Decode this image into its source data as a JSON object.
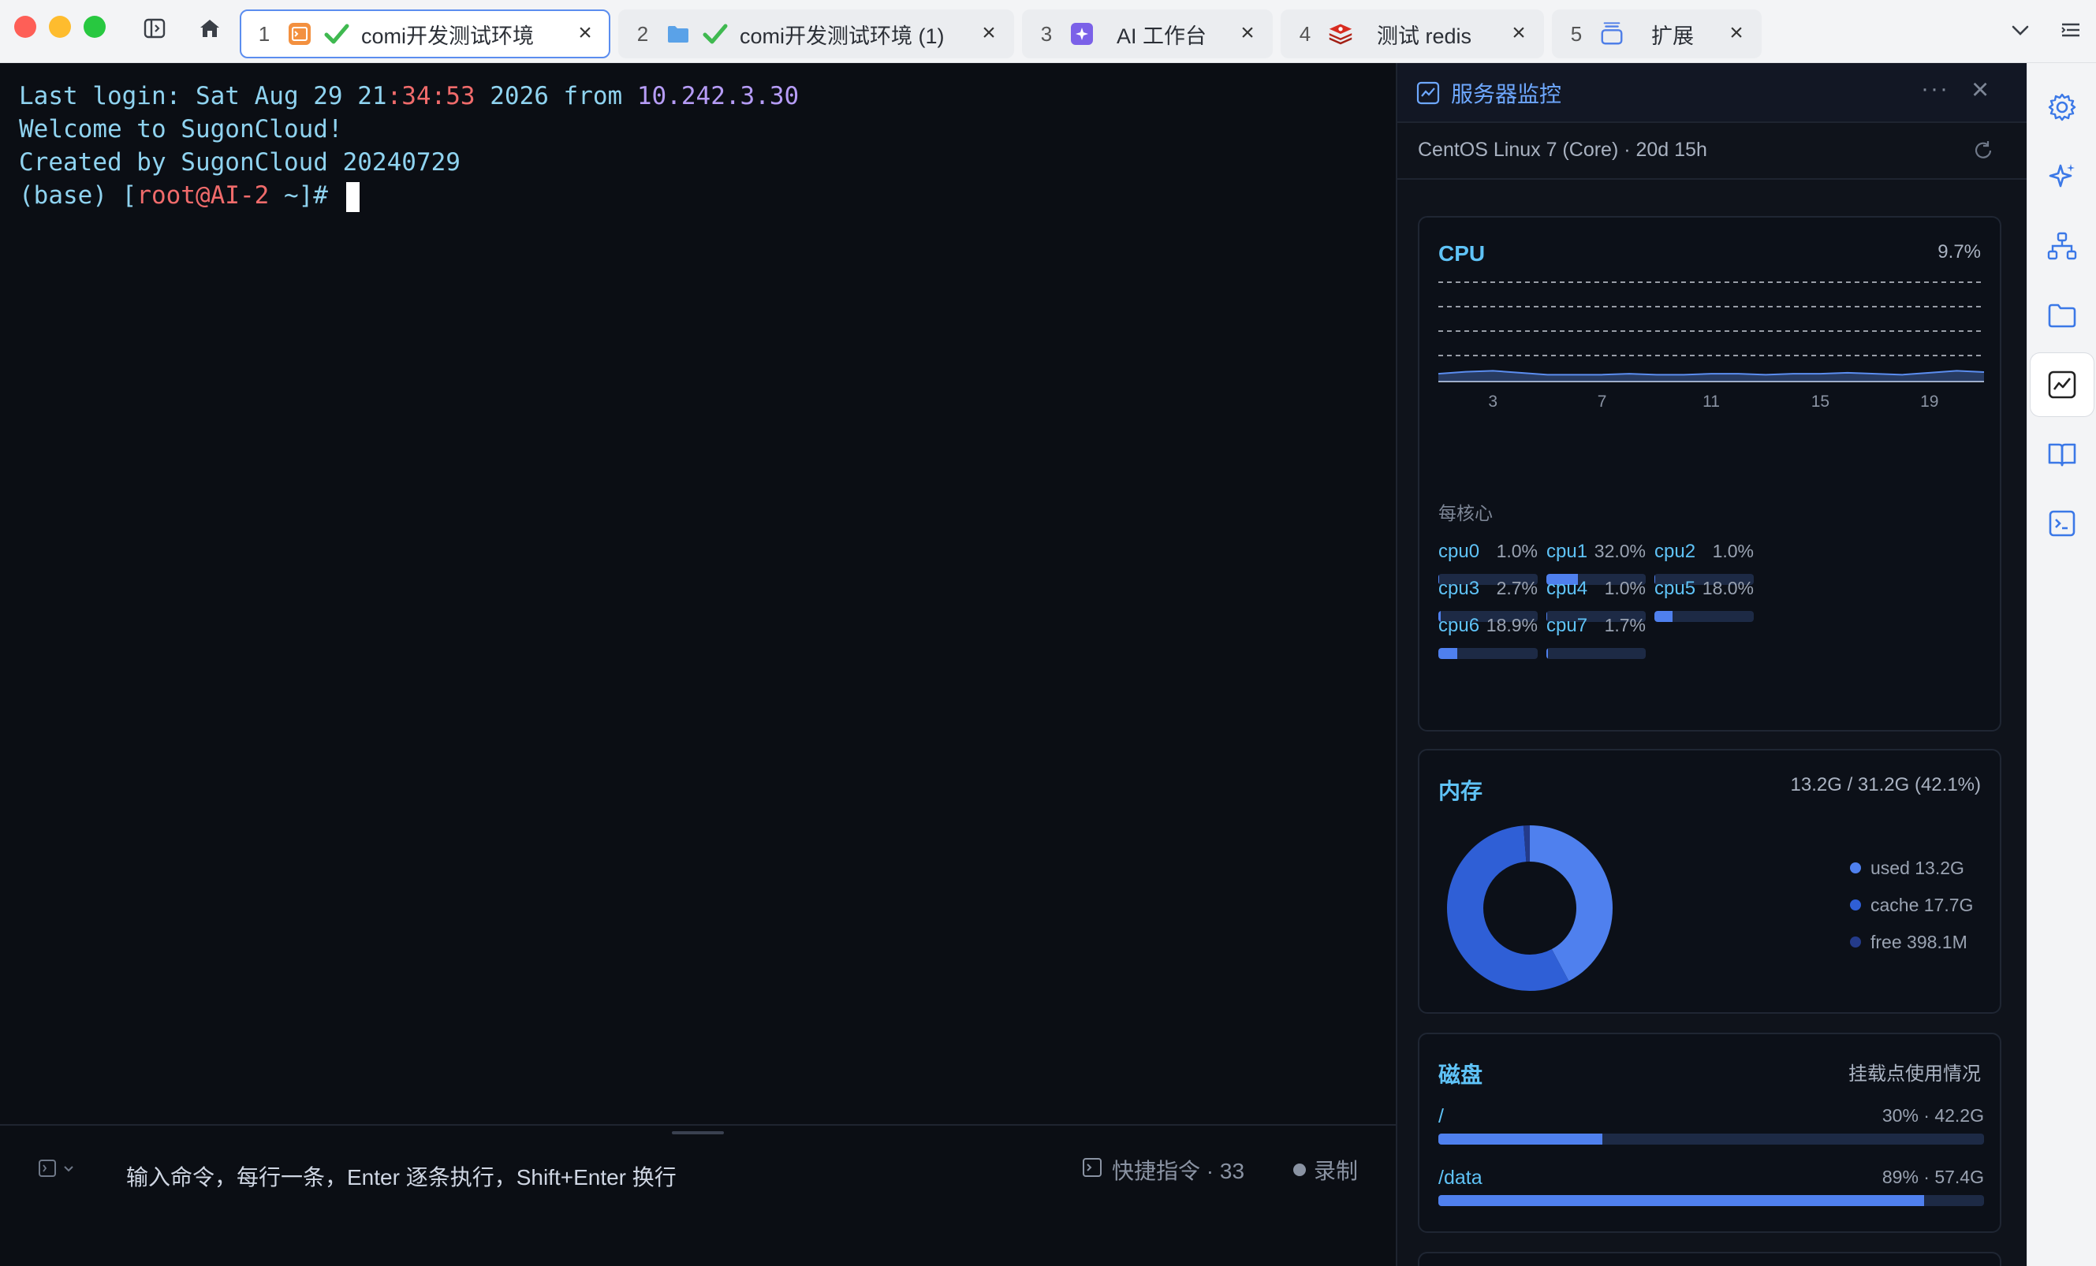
{
  "tabs": [
    {
      "num": "1",
      "label": "comi开发测试环境",
      "icon": "terminal-icon",
      "active": true
    },
    {
      "num": "2",
      "label": "comi开发测试环境 (1)",
      "icon": "folder-icon",
      "active": false
    },
    {
      "num": "3",
      "label": "AI 工作台",
      "icon": "ai-workbench-icon",
      "active": false
    },
    {
      "num": "4",
      "label": "测试 redis",
      "icon": "redis-icon",
      "active": false
    },
    {
      "num": "5",
      "label": "扩展",
      "icon": "extension-icon",
      "active": false
    }
  ],
  "terminal": {
    "line1_a": "Last login: Sat Aug 29 21",
    "line1_b": ":34:53",
    "line1_c": " 2026 from ",
    "line1_d": "10.242.3.30",
    "line2": "Welcome to SugonCloud!",
    "line3": "Created by SugonCloud 20240729",
    "prompt_a": "(base) [",
    "prompt_b": "root@AI-2",
    "prompt_c": " ~]# "
  },
  "input": {
    "placeholder": "输入命令，每行一条，Enter 逐条执行，Shift+Enter 换行",
    "shortcuts": "快捷指令 · 33",
    "record": "录制"
  },
  "monitor": {
    "title": "服务器监控",
    "os": "CentOS Linux 7 (Core) · 20d 15h",
    "cpu": {
      "title": "CPU",
      "usage": "9.7%",
      "per_core_label": "每核心",
      "cores": [
        {
          "name": "cpu0",
          "pct": "1.0%",
          "value": 1.0
        },
        {
          "name": "cpu1",
          "pct": "32.0%",
          "value": 32.0
        },
        {
          "name": "cpu2",
          "pct": "1.0%",
          "value": 1.0
        },
        {
          "name": "cpu3",
          "pct": "2.7%",
          "value": 2.7
        },
        {
          "name": "cpu4",
          "pct": "1.0%",
          "value": 1.0
        },
        {
          "name": "cpu5",
          "pct": "18.0%",
          "value": 18.0
        },
        {
          "name": "cpu6",
          "pct": "18.9%",
          "value": 18.9
        },
        {
          "name": "cpu7",
          "pct": "1.7%",
          "value": 1.7
        }
      ]
    },
    "memory": {
      "title": "内存",
      "summary": "13.2G / 31.2G (42.1%)",
      "legend_used": "used 13.2G",
      "legend_cache": "cache 17.7G",
      "legend_free": "free 398.1M"
    },
    "disk": {
      "title": "磁盘",
      "subtitle": "挂载点使用情况",
      "mounts": [
        {
          "mount": "/",
          "info": "30% · 42.2G",
          "value": 30
        },
        {
          "mount": "/data",
          "info": "89% · 57.4G",
          "value": 89
        }
      ]
    }
  },
  "chart_data": [
    {
      "type": "area",
      "title": "CPU",
      "x": [
        1,
        2,
        3,
        4,
        5,
        6,
        7,
        8,
        9,
        10,
        11,
        12,
        13,
        14,
        15,
        16,
        17,
        18,
        19,
        20,
        21
      ],
      "xticks": [
        "3",
        "7",
        "11",
        "15",
        "19"
      ],
      "series": [
        {
          "values": [
            8,
            10,
            11,
            9,
            7,
            7,
            7,
            8,
            7,
            7,
            8,
            8,
            7,
            8,
            8,
            9,
            8,
            7,
            9,
            11,
            9.7
          ]
        }
      ],
      "ylim": [
        0,
        100
      ],
      "grid": true
    },
    {
      "type": "pie",
      "title": "内存",
      "categories": [
        "used",
        "cache",
        "free"
      ],
      "values": [
        13.2,
        17.7,
        0.4
      ]
    }
  ],
  "colors": {
    "accent": "#5b8def",
    "cpu_series": "#5b8def",
    "mem_used": "#4f80ee",
    "mem_cache": "#2f5fd6",
    "mem_free": "#243b8a"
  }
}
